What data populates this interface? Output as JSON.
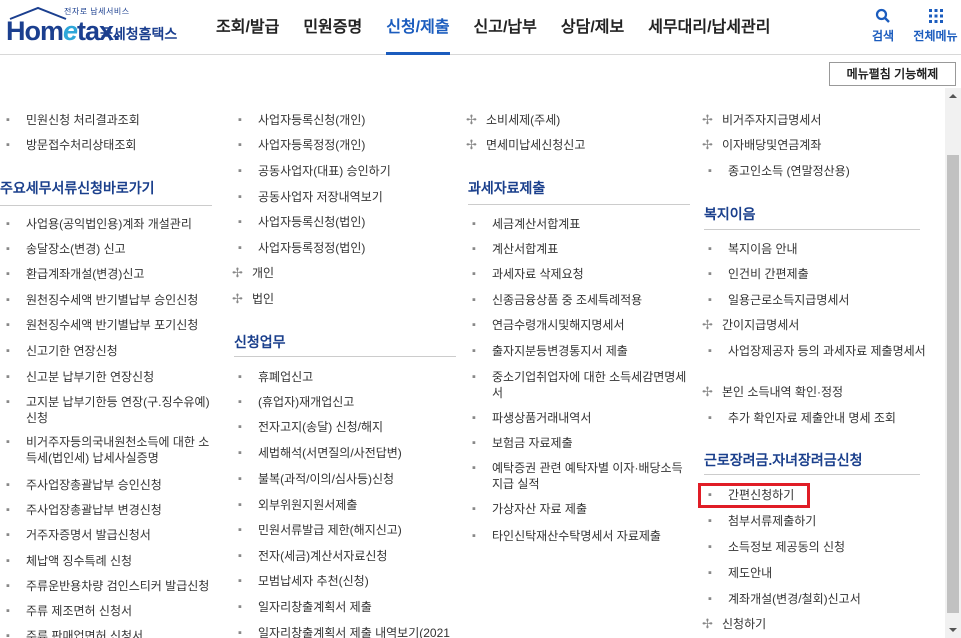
{
  "header": {
    "logo": {
      "tagline": "전자로 납세서비스",
      "brand_pre": "Hom",
      "brand_e": "e",
      "brand_post": "tax.",
      "korean_name": "국세청홈택스"
    },
    "nav": [
      "조회/발급",
      "민원증명",
      "신청/제출",
      "신고/납부",
      "상담/제보",
      "세무대리/납세관리"
    ],
    "active_nav": "신청/제출",
    "search_label": "검색",
    "all_menu_label": "전체메뉴",
    "accent_color": "#1b5cbe"
  },
  "toolbar": {
    "menu_toggle_label": "메뉴펼침 기능해제"
  },
  "columns": {
    "col1": {
      "top_items": [
        "민원신청 처리결과조회",
        "방문접수처리상태조회"
      ],
      "section_title": "주요세무서류신청바로가기",
      "items": [
        "사업용(공익법인용)계좌 개설관리",
        "송달장소(변경) 신고",
        "환급계좌개설(변경)신고",
        "원천징수세액 반기별납부 승인신청",
        "원천징수세액 반기별납부 포기신청",
        "신고기한 연장신청",
        "신고분 납부기한 연장신청",
        "고지분 납부기한등 연장(구.징수유예)신청",
        "비거주자등의국내원천소득에 대한 소득세(법인세) 납세사실증명",
        "주사업장총괄납부 승인신청",
        "주사업장총괄납부 변경신청",
        "거주자증명서 발급신청서",
        "체납액 징수특례 신청",
        "주류운반용차량 검인스티커 발급신청",
        "주류 제조면허 신청서",
        "주류 판매업면허 신청서"
      ]
    },
    "col2": {
      "top_items": [
        "사업자등록신청(개인)",
        "사업자등록정정(개인)",
        "공동사업자(대표) 승인하기",
        "공동사업자 저장내역보기",
        "사업자등록신청(법인)",
        "사업자등록정정(법인)"
      ],
      "expand_items": [
        "개인",
        "법인"
      ],
      "section_title": "신청업무",
      "items": [
        "휴폐업신고",
        "(휴업자)재개업신고",
        "전자고지(송달) 신청/해지",
        "세법해석(서면질의/사전답변)",
        "불복(과적/이의/심사등)신청",
        "외부위원지원서제출",
        "민원서류발급 제한(해지신고)",
        "전자(세금)계산서자료신청",
        "모범납세자 추천(신청)",
        "일자리창출계획서 제출",
        "일자리창출계획서 제출 내역보기(2021"
      ]
    },
    "col3": {
      "top_items": [
        "소비세제(주세)",
        "면세미납세신청신고"
      ],
      "section_title": "과세자료제출",
      "items": [
        "세금계산서합계표",
        "계산서합계표",
        "과세자료 삭제요청",
        "신종금융상품 중 조세특례적용",
        "연금수령개시및해지명세서",
        "출자지분등변경통지서 제출",
        "중소기업취업자에 대한 소득세감면명세서",
        "파생상품거래내역서",
        "보험금 자료제출",
        "예탁증권 관련 예탁자별 이자·배당소득 지급 실적",
        "가상자산 자료 제출",
        "타인신탁재산수탁명세서 자료제출"
      ]
    },
    "col4": {
      "top_items": [
        "비거주자지급명세서",
        "이자배당및연금계좌",
        "종고인소득 (연말정산용)"
      ],
      "section1_title": "복지이음",
      "section1_items": [
        "복지이음 안내",
        "인건비 간편제출",
        "일용근로소득지급명세서",
        "간이지급명세서",
        "사업장제공자 등의 과세자료 제출명세서",
        "본인 소득내역 확인·정정",
        "추가 확인자료 제출안내 명세 조회"
      ],
      "section2_title": "근로장려금.자녀장려금신청",
      "section2_items": [
        "간편신청하기",
        "첨부서류제출하기",
        "소득정보 제공동의 신청",
        "제도안내",
        "계좌개설(변경/철회)신고서",
        "신청하기"
      ]
    }
  }
}
